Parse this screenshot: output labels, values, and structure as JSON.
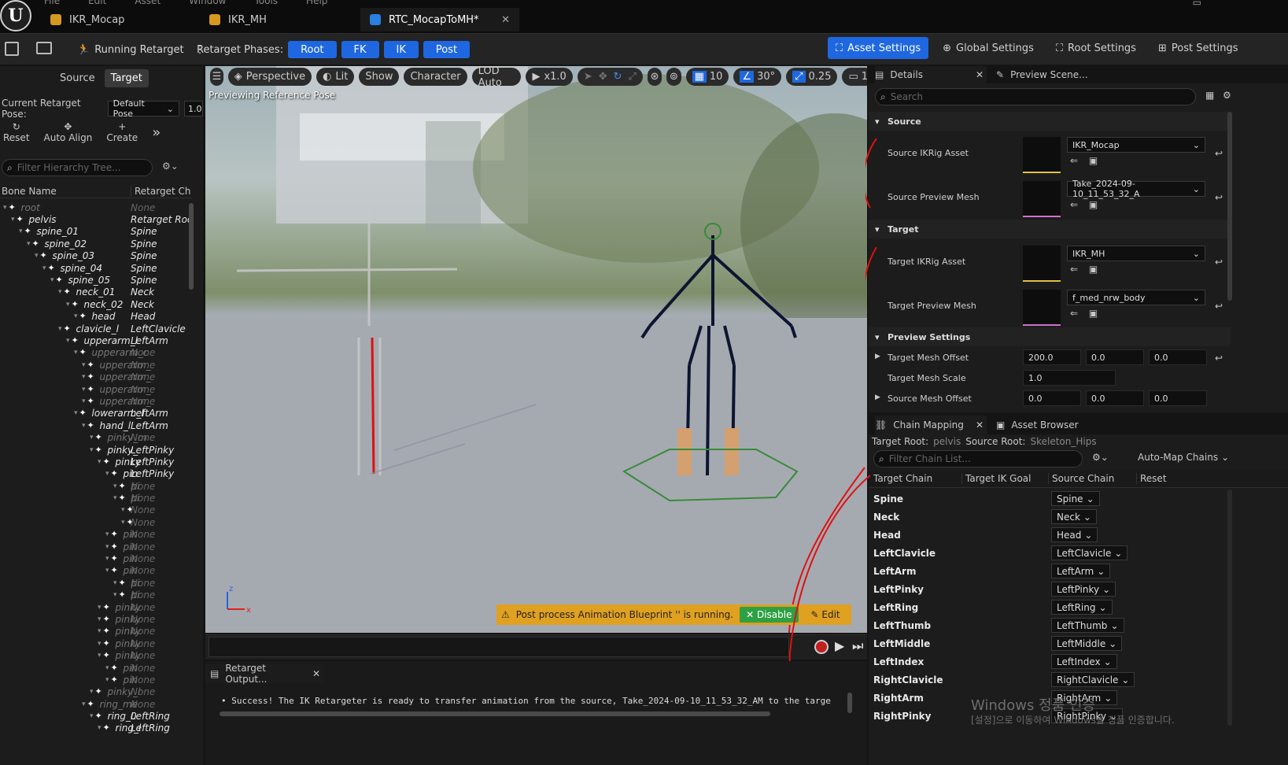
{
  "menu": [
    "File",
    "Edit",
    "Asset",
    "Window",
    "Tools",
    "Help"
  ],
  "tabs": [
    {
      "label": "IKR_Mocap",
      "active": false
    },
    {
      "label": "IKR_MH",
      "active": false
    },
    {
      "label": "RTC_MocapToMH*",
      "active": true
    }
  ],
  "toolbar": {
    "running": "Running Retarget",
    "phases_label": "Retarget Phases:",
    "phases": [
      "Root",
      "FK",
      "IK",
      "Post"
    ],
    "settings": [
      "Asset Settings",
      "Global Settings",
      "Root Settings",
      "Post Settings"
    ]
  },
  "left": {
    "tabs": [
      "Source",
      "Target"
    ],
    "pose_label": "Current Retarget Pose:",
    "pose_value": "Default Pose",
    "pose_extra": "1.0",
    "actions": [
      "Reset",
      "Auto Align",
      "Create"
    ],
    "filter_placeholder": "Filter Hierarchy Tree...",
    "col_bone": "Bone Name",
    "col_chain": "Retarget Ch",
    "rows": [
      {
        "name": "root",
        "chain": "None",
        "indent": 0,
        "dim": true
      },
      {
        "name": "pelvis",
        "chain": "Retarget Roo",
        "indent": 1,
        "dim": false
      },
      {
        "name": "spine_01",
        "chain": "Spine",
        "indent": 2,
        "dim": false
      },
      {
        "name": "spine_02",
        "chain": "Spine",
        "indent": 3,
        "dim": false
      },
      {
        "name": "spine_03",
        "chain": "Spine",
        "indent": 4,
        "dim": false
      },
      {
        "name": "spine_04",
        "chain": "Spine",
        "indent": 5,
        "dim": false
      },
      {
        "name": "spine_05",
        "chain": "Spine",
        "indent": 6,
        "dim": false
      },
      {
        "name": "neck_01",
        "chain": "Neck",
        "indent": 7,
        "dim": false
      },
      {
        "name": "neck_02",
        "chain": "Neck",
        "indent": 8,
        "dim": false
      },
      {
        "name": "head",
        "chain": "Head",
        "indent": 9,
        "dim": false
      },
      {
        "name": "clavicle_l",
        "chain": "LeftClavicle",
        "indent": 7,
        "dim": false
      },
      {
        "name": "upperarm_l",
        "chain": "LeftArm",
        "indent": 8,
        "dim": false
      },
      {
        "name": "upperarm_c",
        "chain": "None",
        "indent": 9,
        "dim": true
      },
      {
        "name": "upperarm_",
        "chain": "None",
        "indent": 10,
        "dim": true
      },
      {
        "name": "upperarm_",
        "chain": "None",
        "indent": 10,
        "dim": true
      },
      {
        "name": "upperarm_",
        "chain": "None",
        "indent": 10,
        "dim": true
      },
      {
        "name": "upperarm_",
        "chain": "None",
        "indent": 10,
        "dim": true
      },
      {
        "name": "lowerarm_l",
        "chain": "LeftArm",
        "indent": 9,
        "dim": false
      },
      {
        "name": "hand_l",
        "chain": "LeftArm",
        "indent": 10,
        "dim": false
      },
      {
        "name": "pinky_m",
        "chain": "None",
        "indent": 11,
        "dim": true
      },
      {
        "name": "pinky_",
        "chain": "LeftPinky",
        "indent": 11,
        "dim": false
      },
      {
        "name": "pinky",
        "chain": "LeftPinky",
        "indent": 12,
        "dim": false
      },
      {
        "name": "pin",
        "chain": "LeftPinky",
        "indent": 13,
        "dim": false
      },
      {
        "name": "pi",
        "chain": "None",
        "indent": 14,
        "dim": true
      },
      {
        "name": "pi",
        "chain": "None",
        "indent": 14,
        "dim": true
      },
      {
        "name": "",
        "chain": "None",
        "indent": 15,
        "dim": true
      },
      {
        "name": "",
        "chain": "None",
        "indent": 15,
        "dim": true
      },
      {
        "name": "pin",
        "chain": "None",
        "indent": 13,
        "dim": true
      },
      {
        "name": "pin",
        "chain": "None",
        "indent": 13,
        "dim": true
      },
      {
        "name": "pin",
        "chain": "None",
        "indent": 13,
        "dim": true
      },
      {
        "name": "pin",
        "chain": "None",
        "indent": 13,
        "dim": true
      },
      {
        "name": "pi",
        "chain": "None",
        "indent": 14,
        "dim": true
      },
      {
        "name": "pi",
        "chain": "None",
        "indent": 14,
        "dim": true
      },
      {
        "name": "pinky",
        "chain": "None",
        "indent": 12,
        "dim": true
      },
      {
        "name": "pinky",
        "chain": "None",
        "indent": 12,
        "dim": true
      },
      {
        "name": "pinky",
        "chain": "None",
        "indent": 12,
        "dim": true
      },
      {
        "name": "pinky",
        "chain": "None",
        "indent": 12,
        "dim": true
      },
      {
        "name": "pinky",
        "chain": "None",
        "indent": 12,
        "dim": true
      },
      {
        "name": "pin",
        "chain": "None",
        "indent": 13,
        "dim": true
      },
      {
        "name": "pin",
        "chain": "None",
        "indent": 13,
        "dim": true
      },
      {
        "name": "pinky_l",
        "chain": "None",
        "indent": 11,
        "dim": true
      },
      {
        "name": "ring_me",
        "chain": "None",
        "indent": 10,
        "dim": true
      },
      {
        "name": "ring_0",
        "chain": "LeftRing",
        "indent": 11,
        "dim": false
      },
      {
        "name": "ring_l",
        "chain": "LeftRing",
        "indent": 12,
        "dim": false
      }
    ]
  },
  "viewport": {
    "perspective": "Perspective",
    "lit": "Lit",
    "show": "Show",
    "character": "Character",
    "lod": "LOD Auto",
    "speed": "x1.0",
    "grid": "10",
    "angle": "30°",
    "scale": "0.25",
    "cam": "1",
    "overlay": "Previewing Reference Pose",
    "warning": "Post process Animation Blueprint '' is running.",
    "disable": "Disable",
    "edit": "Edit"
  },
  "details": {
    "tab": "Details",
    "tab2": "Preview Scene...",
    "search_placeholder": "Search",
    "sections": {
      "source": "Source",
      "target": "Target",
      "preview": "Preview Settings"
    },
    "source_ikrig_label": "Source IKRig Asset",
    "source_ikrig_value": "IKR_Mocap",
    "source_mesh_label": "Source Preview Mesh",
    "source_mesh_value": "Take_2024-09-10_11_53_32_A",
    "target_ikrig_label": "Target IKRig Asset",
    "target_ikrig_value": "IKR_MH",
    "target_mesh_label": "Target Preview Mesh",
    "target_mesh_value": "f_med_nrw_body",
    "target_offset_label": "Target Mesh Offset",
    "target_offset": [
      "200.0",
      "0.0",
      "0.0"
    ],
    "target_scale_label": "Target Mesh Scale",
    "target_scale": "1.0",
    "source_offset_label": "Source Mesh Offset",
    "source_offset": [
      "0.0",
      "0.0",
      "0.0"
    ]
  },
  "chain": {
    "tab": "Chain Mapping",
    "tab2": "Asset Browser",
    "target_root_label": "Target Root:",
    "target_root": "pelvis",
    "source_root_label": "Source Root:",
    "source_root": "Skeleton_Hips",
    "filter_placeholder": "Filter Chain List...",
    "automap": "Auto-Map Chains",
    "cols": [
      "Target Chain",
      "Target IK Goal",
      "Source Chain",
      "Reset"
    ],
    "rows": [
      {
        "target": "Spine",
        "source": "Spine"
      },
      {
        "target": "Neck",
        "source": "Neck"
      },
      {
        "target": "Head",
        "source": "Head"
      },
      {
        "target": "LeftClavicle",
        "source": "LeftClavicle"
      },
      {
        "target": "LeftArm",
        "source": "LeftArm"
      },
      {
        "target": "LeftPinky",
        "source": "LeftPinky"
      },
      {
        "target": "LeftRing",
        "source": "LeftRing"
      },
      {
        "target": "LeftThumb",
        "source": "LeftThumb"
      },
      {
        "target": "LeftMiddle",
        "source": "LeftMiddle"
      },
      {
        "target": "LeftIndex",
        "source": "LeftIndex"
      },
      {
        "target": "RightClavicle",
        "source": "RightClavicle"
      },
      {
        "target": "RightArm",
        "source": "RightArm"
      },
      {
        "target": "RightPinky",
        "source": "RightPinky"
      }
    ]
  },
  "output": {
    "tab": "Retarget Output...",
    "message": "Success! The IK Retargeter is ready to transfer animation from the source, Take_2024-09-10_11_53_32_AM to the targe"
  },
  "watermark": {
    "line1": "Windows 정품 인증",
    "line2": "[설정]으로 이동하여 Windows를 정품 인증합니다."
  },
  "colors": {
    "accent": "#1f67e0",
    "warning": "#e0a020",
    "annotation": "#e01010"
  }
}
